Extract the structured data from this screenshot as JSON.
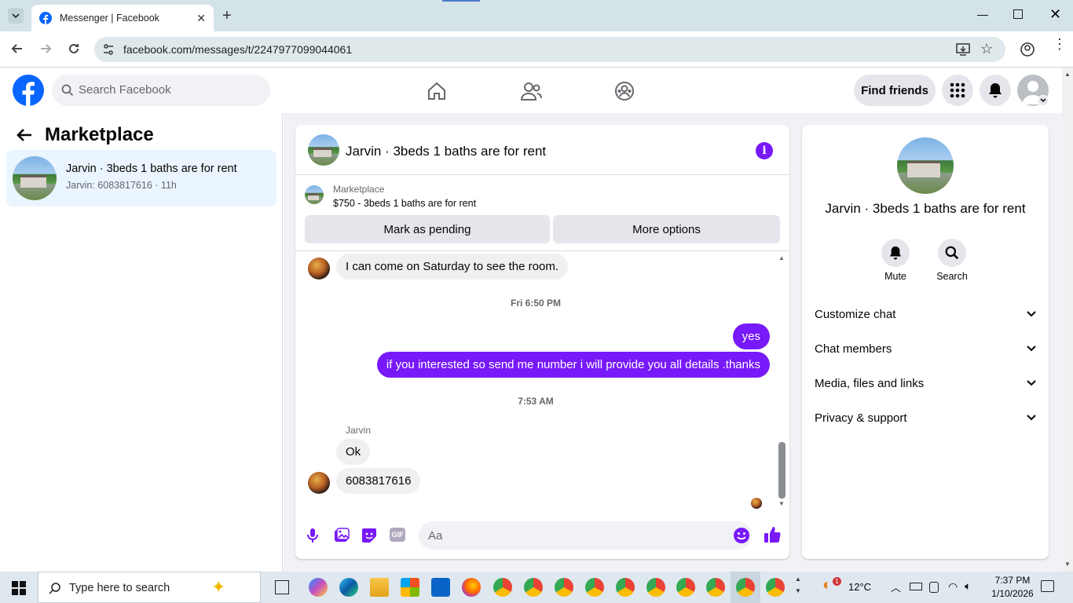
{
  "browser": {
    "tab_title": "Messenger | Facebook",
    "url": "facebook.com/messages/t/2247977099044061"
  },
  "header": {
    "search_placeholder": "Search Facebook",
    "find_friends": "Find friends"
  },
  "left_panel": {
    "title": "Marketplace",
    "conversations": [
      {
        "name": "Jarvin · 3beds 1 baths are for rent",
        "preview": "Jarvin: 6083817616 · 11h"
      }
    ]
  },
  "chat": {
    "title": "Jarvin · 3beds 1 baths are for rent",
    "listing": {
      "label": "Marketplace",
      "description": "$750 - 3beds 1 baths are for rent",
      "mark_pending": "Mark as pending",
      "more_options": "More options"
    },
    "messages": [
      {
        "from": "them",
        "text": "I can come on Saturday to see the room."
      },
      {
        "timestamp": "Fri 6:50 PM"
      },
      {
        "from": "me",
        "text": "yes"
      },
      {
        "from": "me",
        "text": "if you interested so send me number i will provide you all details .thanks"
      },
      {
        "timestamp": "7:53 AM"
      },
      {
        "sender_name": "Jarvin"
      },
      {
        "from": "them",
        "text": "Ok"
      },
      {
        "from": "them",
        "text": "6083817616"
      }
    ],
    "composer_placeholder": "Aa"
  },
  "right_panel": {
    "title": "Jarvin · 3beds 1 baths are for rent",
    "actions": [
      {
        "label": "Mute"
      },
      {
        "label": "Search"
      }
    ],
    "sections": [
      "Customize chat",
      "Chat members",
      "Media, files and links",
      "Privacy & support"
    ]
  },
  "taskbar": {
    "search_placeholder": "Type here to search",
    "weather": "12°C",
    "weather_badge": "1",
    "time": "7:37 PM",
    "date": "1/10/2026"
  },
  "colors": {
    "accent": "#7719f8",
    "facebook_blue": "#0866ff",
    "selected_bg": "#ebf5ff"
  }
}
